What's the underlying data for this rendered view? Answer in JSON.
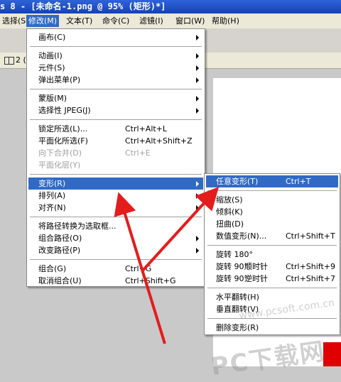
{
  "window": {
    "title": "s 8 - [未命名-1.png @  95% (矩形)*]"
  },
  "menubar": [
    {
      "label": "选择(S)",
      "active": false
    },
    {
      "label": "修改(M)",
      "active": true
    },
    {
      "label": "文本(T)",
      "active": false
    },
    {
      "label": "命令(C)",
      "active": false
    },
    {
      "label": "滤镜(I)",
      "active": false
    },
    {
      "label": "窗口(W)",
      "active": false
    },
    {
      "label": "帮助(H)",
      "active": false
    }
  ],
  "toolbar": {
    "tab_label": "2 ("
  },
  "modify_menu": {
    "items": [
      {
        "label": "画布(C)",
        "shortcut": "",
        "submenu": true
      },
      {
        "sep": true
      },
      {
        "label": "动画(I)",
        "shortcut": "",
        "submenu": true
      },
      {
        "label": "元件(S)",
        "shortcut": "",
        "submenu": true
      },
      {
        "label": "弹出菜单(P)",
        "shortcut": "",
        "submenu": true
      },
      {
        "sep": true
      },
      {
        "label": "蒙版(M)",
        "shortcut": "",
        "submenu": true
      },
      {
        "label": "选择性 JPEG(J)",
        "shortcut": "",
        "submenu": true
      },
      {
        "sep": true
      },
      {
        "label": "锁定所选(L)...",
        "shortcut": "Ctrl+Alt+L"
      },
      {
        "label": "平面化所选(F)",
        "shortcut": "Ctrl+Alt+Shift+Z"
      },
      {
        "label": "向下合并(D)",
        "shortcut": "Ctrl+E",
        "disabled": true
      },
      {
        "label": "平面化层(Y)",
        "shortcut": "",
        "disabled": true
      },
      {
        "sep": true
      },
      {
        "label": "变形(R)",
        "shortcut": "",
        "submenu": true,
        "highlighted": true
      },
      {
        "label": "排列(A)",
        "shortcut": "",
        "submenu": true
      },
      {
        "label": "对齐(N)",
        "shortcut": "",
        "submenu": true
      },
      {
        "sep": true
      },
      {
        "label": "将路径转换为选取框...",
        "shortcut": ""
      },
      {
        "label": "组合路径(O)",
        "shortcut": "",
        "submenu": true
      },
      {
        "label": "改变路径(P)",
        "shortcut": "",
        "submenu": true
      },
      {
        "sep": true
      },
      {
        "label": "组合(G)",
        "shortcut": "Ctrl+G"
      },
      {
        "label": "取消组合(U)",
        "shortcut": "Ctrl+Shift+G"
      }
    ]
  },
  "transform_submenu": {
    "items": [
      {
        "label": "任意变形(T)",
        "mid": "",
        "shortcut": "Ctrl+T",
        "highlighted": true
      },
      {
        "sep": true
      },
      {
        "label": "缩放(S)",
        "mid": "",
        "shortcut": ""
      },
      {
        "label": "倾斜(K)",
        "mid": "",
        "shortcut": ""
      },
      {
        "label": "扭曲(D)",
        "mid": "",
        "shortcut": ""
      },
      {
        "label": "数值变形(N)...",
        "mid": "",
        "shortcut": "Ctrl+Shift+T"
      },
      {
        "sep": true
      },
      {
        "label": "旋转 180°",
        "mid": "",
        "shortcut": ""
      },
      {
        "label": "旋转 90°",
        "mid": "顺时针",
        "shortcut": "Ctrl+Shift+9"
      },
      {
        "label": "旋转 90°",
        "mid": "逆时针",
        "shortcut": "Ctrl+Shift+7"
      },
      {
        "sep": true
      },
      {
        "label": "水平翻转(H)",
        "mid": "",
        "shortcut": ""
      },
      {
        "label": "垂直翻转(V)",
        "mid": "",
        "shortcut": ""
      },
      {
        "sep": true
      },
      {
        "label": "删除变形(R)",
        "mid": "",
        "shortcut": ""
      }
    ]
  },
  "watermark": {
    "text": "PC下载网",
    "url": "www.pcsoft.com.cn"
  },
  "colors": {
    "highlight": "#316ac5",
    "titlebar": "#1442b5",
    "arrow": "#e41c1c"
  },
  "icons": [
    "submenu-arrow-icon",
    "layout-tab-icon"
  ]
}
